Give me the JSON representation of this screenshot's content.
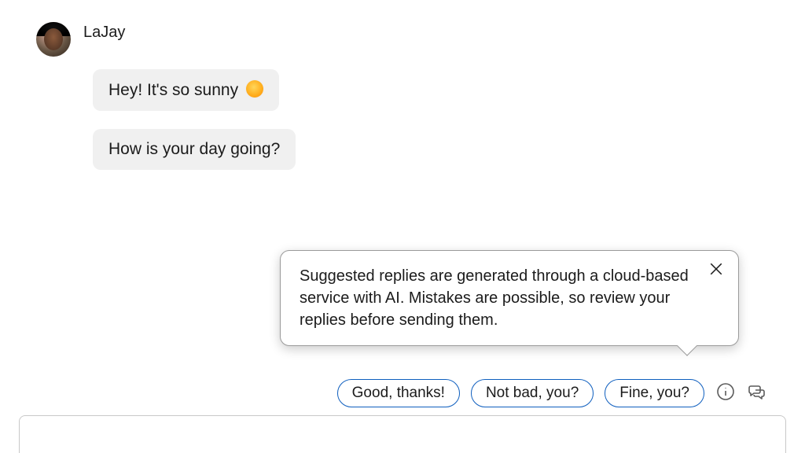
{
  "sender": {
    "name": "LaJay"
  },
  "messages": [
    {
      "text": "Hey! It's so sunny"
    },
    {
      "text": "How is your day going?"
    }
  ],
  "tooltip": {
    "text": "Suggested replies are generated through a cloud-based service with AI. Mistakes are possible, so review your replies before sending them."
  },
  "suggestions": [
    {
      "label": "Good, thanks!"
    },
    {
      "label": "Not bad, you?"
    },
    {
      "label": "Fine, you?"
    }
  ],
  "input": {
    "placeholder": ""
  }
}
